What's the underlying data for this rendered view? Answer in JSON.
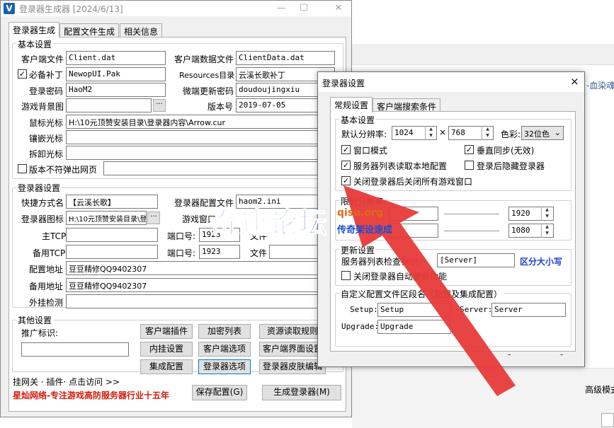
{
  "background": {
    "right_text": "-血染魂",
    "bottom_right_label": "高级模式"
  },
  "window": {
    "title": "登录器生成器 [2024/6/13]",
    "app_icon": "V",
    "tabs": [
      {
        "label": "登录器生成"
      },
      {
        "label": "配置文件生成"
      },
      {
        "label": "相关信息"
      }
    ],
    "basic": {
      "title": "基本设置",
      "client_file_label": "客户端文件",
      "client_file_value": "Client.dat",
      "client_data_label": "客户端数据文件",
      "client_data_value": "ClientData.dat",
      "patch_label": "必备补丁",
      "patch_value": "NewopUI.Pak",
      "resources_label": "Resources目录",
      "resources_value": "云溪长歌补丁",
      "password_label": "登录密码",
      "password_value": "HaoM2",
      "micro_label": "微端更新密码",
      "micro_value": "doudoujingxiu",
      "bg_label": "游戏背景图",
      "bg_value": "",
      "version_label": "版本号",
      "version_value": "2019-07-05",
      "cursor_label": "鼠标光标",
      "cursor_value": "H:\\10元顶赞安装目录\\登录器内容\\Arrow.cur",
      "inlay_label": "镶嵌光标",
      "inlay_value": "",
      "unload_label": "拆卸光标",
      "unload_value": "",
      "noweb_label": "版本不符弹出网页",
      "noweb_value": ""
    },
    "launcher": {
      "title": "登录器设置",
      "shortcut_label": "快捷方式名",
      "shortcut_value": "【云溪长歌】",
      "config_file_label": "登录器配置文件",
      "config_file_value": "haom2.ini",
      "icon_label": "登录器图标",
      "icon_value": "H:\\10元顶赞安装目录\\登录",
      "game_window_label": "游戏窗口",
      "main_tcp_label": "主TCP",
      "main_tcp_value": "",
      "port_label": "端口号:",
      "port1_value": "1923",
      "port2_value": "1923",
      "file_label": "文件",
      "backup_tcp_label": "备用TCP",
      "backup_tcp_value": "",
      "config_addr_label": "配置地址",
      "config_addr_value": "豆豆精修QQ9402307",
      "backup_addr_label": "备用地址",
      "backup_addr_value": "豆豆精修QQ9402307",
      "plugin_check_label": "外挂检测",
      "plugin_check_value": ""
    },
    "other": {
      "title": "其他设置",
      "promo_label": "推广标识:",
      "promo_value": "",
      "buttons": [
        "客户端插件",
        "加密列表",
        "资源读取规则",
        "内挂设置",
        "客户端选项",
        "客户端界面设置",
        "集成配置",
        "登录器选项",
        "登录器皮肤编辑"
      ],
      "links": "挂网关 · 插件· 点击访问 >>",
      "slogan": "星灿网络-专注游戏高防服务器行业十五年",
      "save_button": "保存配置(G)",
      "generate_button": "生成登录器(M)"
    }
  },
  "dialog": {
    "title": "登录器设置",
    "close": "×",
    "tabs": [
      {
        "label": "常规设置"
      },
      {
        "label": "客户端搜索条件"
      }
    ],
    "basic": {
      "title": "基本设置",
      "resolution_label": "默认分辨率:",
      "width": "1024",
      "times": "×",
      "height": "768",
      "color_label": "色彩:",
      "color_value": "32位色",
      "window_mode": "窗口模式",
      "vsync": "垂直同步(无效)",
      "read_local": "服务器列表读取本地配置",
      "hide_after": "登录后隐藏登录器",
      "close_all": "关闭登录器后关闭所有游戏窗口"
    },
    "limit": {
      "title": "限制分辨率",
      "max_w": "1920",
      "max_h": "1080"
    },
    "update": {
      "title": "更新设置",
      "list_label": "服务器列表检查标识:",
      "list_value": "[Server]",
      "case_note": "区分大小写",
      "close_update": "关闭登录器自动更新功能"
    },
    "custom": {
      "title": "自定义配置文件区段名（配置及集成配置）",
      "setup_label": "Setup:",
      "setup_value": "Setup",
      "server_label": "Server:",
      "server_value": "Server",
      "upgrade_label": "Upgrade:",
      "upgrade_value": "Upgrade"
    }
  },
  "watermark": {
    "main": "奇速论坛",
    "site": "qisu.org",
    "sub": "传奇架设速成"
  },
  "colors": {
    "arrow": "#e83a3a",
    "watermark_blue": "#1b4fd0",
    "slogan_red": "#d4180a"
  }
}
